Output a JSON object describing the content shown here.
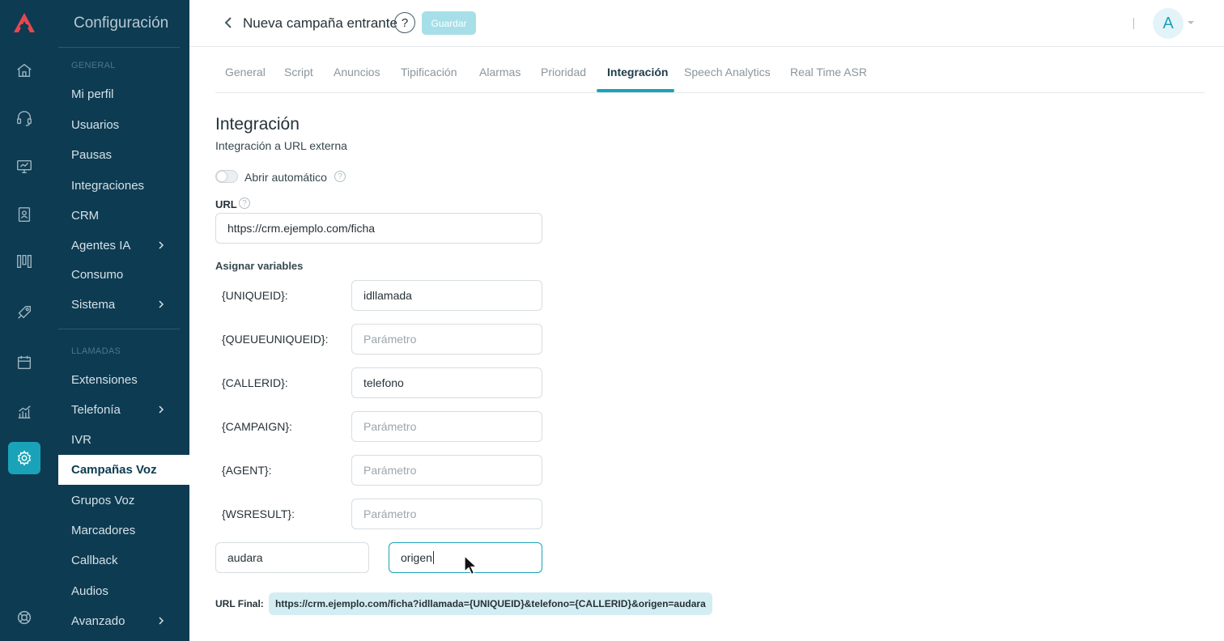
{
  "sidebar": {
    "title": "Configuración",
    "section_general": "GENERAL",
    "section_llamadas": "LLAMADAS",
    "items": [
      {
        "label": "Mi perfil"
      },
      {
        "label": "Usuarios"
      },
      {
        "label": "Pausas"
      },
      {
        "label": "Integraciones"
      },
      {
        "label": "CRM"
      },
      {
        "label": "Agentes IA"
      },
      {
        "label": "Consumo"
      },
      {
        "label": "Sistema"
      },
      {
        "label": "Extensiones"
      },
      {
        "label": "Telefonía"
      },
      {
        "label": "IVR"
      },
      {
        "label": "Campañas Voz"
      },
      {
        "label": "Grupos Voz"
      },
      {
        "label": "Marcadores"
      },
      {
        "label": "Callback"
      },
      {
        "label": "Audios"
      },
      {
        "label": "Avanzado"
      }
    ]
  },
  "header": {
    "title": "Nueva campaña entrante",
    "help_label": "?",
    "save_label": "Guardar",
    "avatar_initial": "A"
  },
  "tabs": [
    {
      "label": "General"
    },
    {
      "label": "Script"
    },
    {
      "label": "Anuncios"
    },
    {
      "label": "Tipificación"
    },
    {
      "label": "Alarmas"
    },
    {
      "label": "Prioridad"
    },
    {
      "label": "Integración"
    },
    {
      "label": "Speech Analytics"
    },
    {
      "label": "Real Time ASR"
    }
  ],
  "content": {
    "heading": "Integración",
    "subtitle": "Integración a URL externa",
    "auto_open_label": "Abrir automático",
    "auto_open_enabled": false,
    "url_label": "URL",
    "url_value": "https://crm.ejemplo.com/ficha",
    "assign_label": "Asignar variables",
    "variables": [
      {
        "name": "{UNIQUEID}:",
        "value": "idllamada",
        "placeholder": "Parámetro"
      },
      {
        "name": "{QUEUEUNIQUEID}:",
        "value": "",
        "placeholder": "Parámetro"
      },
      {
        "name": "{CALLERID}:",
        "value": "telefono",
        "placeholder": "Parámetro"
      },
      {
        "name": "{CAMPAIGN}:",
        "value": "",
        "placeholder": "Parámetro"
      },
      {
        "name": "{AGENT}:",
        "value": "",
        "placeholder": "Parámetro"
      },
      {
        "name": "{WSRESULT}:",
        "value": "",
        "placeholder": "Parámetro"
      }
    ],
    "custom_var_value": "audara",
    "custom_param_value": "origen",
    "final_url_label": "URL Final:",
    "final_url_value": "https://crm.ejemplo.com/ficha?idllamada={UNIQUEID}&telefono={CALLERID}&origen=audara"
  },
  "colors": {
    "sidebar_bg": "#0d3b52",
    "accent": "#1aa3b8",
    "save_disabled": "#a6dfe8",
    "final_url_bg": "#d4edf2"
  }
}
